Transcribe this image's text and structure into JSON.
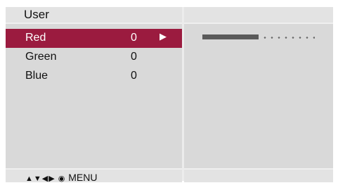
{
  "menu": {
    "title": "User",
    "selected_index": 0,
    "items": [
      {
        "label": "Red",
        "value": "0"
      },
      {
        "label": "Green",
        "value": "0"
      },
      {
        "label": "Blue",
        "value": "0"
      }
    ],
    "submenu_arrow": "▶"
  },
  "slider": {
    "fill_fraction": 0.5
  },
  "footer": {
    "nav_glyphs": "▲▼◀▶ ◉",
    "menu_label": "MENU"
  },
  "colors": {
    "selection": "#9b1b3f",
    "panel": "#d9d9d9",
    "slider_fill": "#5a5a5a"
  }
}
